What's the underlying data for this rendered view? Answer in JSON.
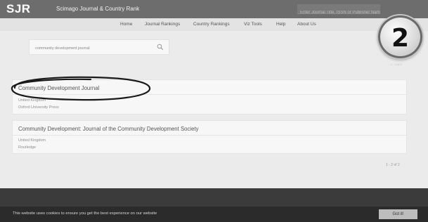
{
  "header": {
    "logo": "SJR",
    "site_name": "Scimago Journal & Country Rank",
    "search_placeholder": "Enter Journal Title, ISSN or Publisher Name"
  },
  "nav": {
    "items": [
      "Home",
      "Journal Rankings",
      "Country Rankings",
      "Viz Tools",
      "Help",
      "About Us"
    ]
  },
  "search": {
    "value": "community development journal"
  },
  "results": [
    {
      "title": "Community Development Journal",
      "country": "United Kingdom",
      "publisher": "Oxford University Press"
    },
    {
      "title": "Community Development: Journal of the Community Development Society",
      "country": "United Kingdom",
      "publisher": "Routledge"
    }
  ],
  "pagination": {
    "label": "1 - 2 of 2"
  },
  "badge": {
    "number": "2"
  },
  "cookie": {
    "message": "This website uses cookies to ensure you get the best experience on our website",
    "button": "Got it!"
  },
  "icons": {
    "search": "search-icon",
    "annotation": "hand-drawn-ellipse",
    "step": "step-number-badge"
  }
}
